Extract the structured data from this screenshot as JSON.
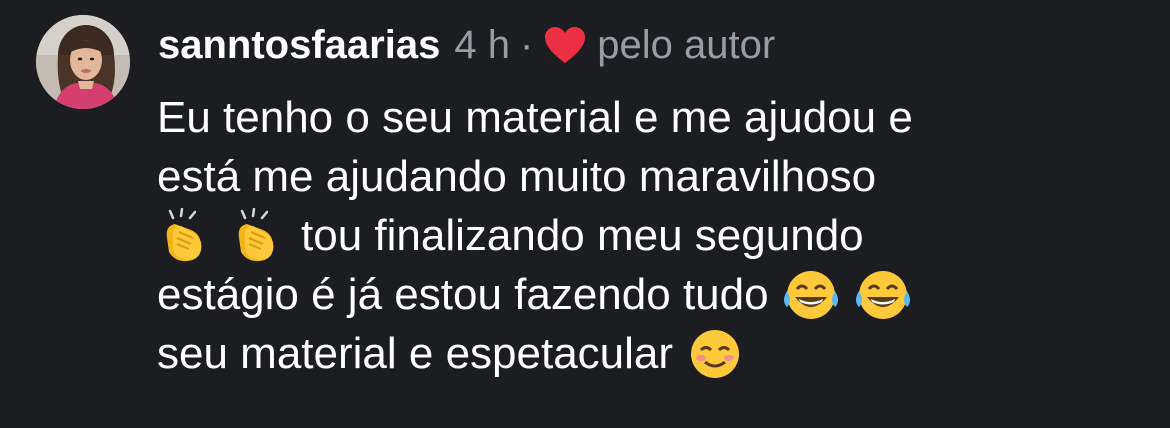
{
  "comment": {
    "username": "sanntosfaarias",
    "time": "4 h",
    "separator": "·",
    "liked_by": "pelo autor",
    "lines": [
      "Eu tenho o seu material e me ajudou e",
      "está me ajudando muito maravilhoso",
      "tou finalizando meu segundo",
      "estágio é já estou fazendo tudo",
      "seu material e espetacular"
    ],
    "emojis": {
      "line3_prefix": [
        "clapping-hands",
        "clapping-hands"
      ],
      "line4_suffix": [
        "face-with-tears-of-joy",
        "face-with-tears-of-joy"
      ],
      "line5_suffix": [
        "smiling-face"
      ]
    }
  },
  "colors": {
    "background": "#1c1d21",
    "text": "#ffffff",
    "muted": "#9b9ca2",
    "heart": "#ed2f44"
  }
}
